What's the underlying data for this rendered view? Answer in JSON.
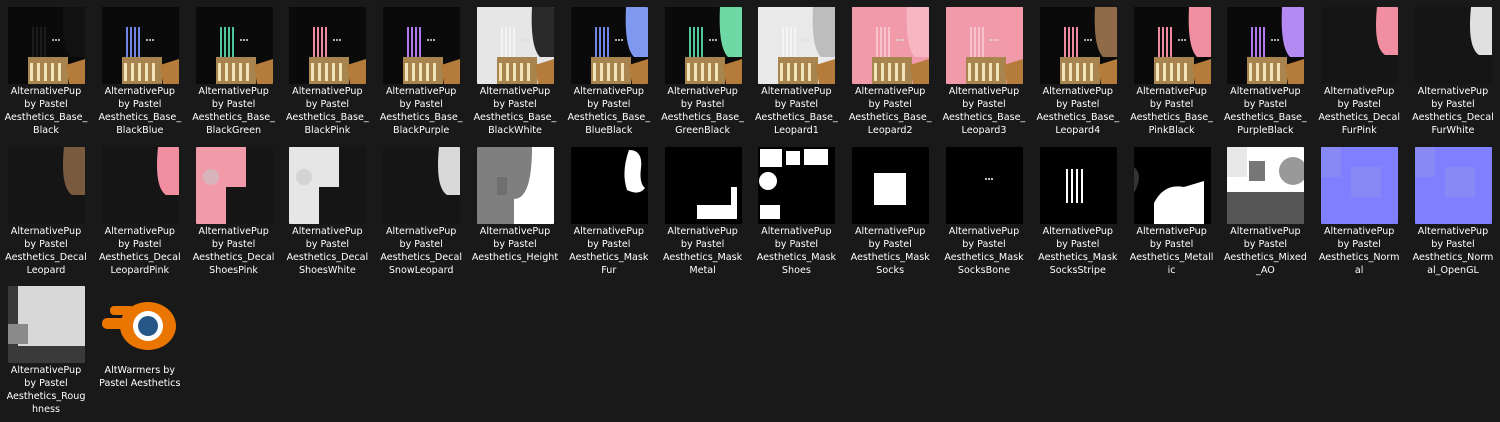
{
  "window": {
    "view": "Large icons"
  },
  "files": [
    {
      "name": "AlternativePup\nby Pastel\nAesthetics_Base_\nBlack",
      "kind": "base",
      "primary": "#0a0a0a",
      "stripe": "#1c1c1c",
      "decal": "#111111"
    },
    {
      "name": "AlternativePup\nby Pastel\nAesthetics_Base_\nBlackBlue",
      "kind": "base",
      "primary": "#0a0a0a",
      "stripe": "#6f86e6",
      "decal": "#0a0a0a"
    },
    {
      "name": "AlternativePup\nby Pastel\nAesthetics_Base_\nBlackGreen",
      "kind": "base",
      "primary": "#0a0a0a",
      "stripe": "#4fc79a",
      "decal": "#0a0a0a"
    },
    {
      "name": "AlternativePup\nby Pastel\nAesthetics_Base_\nBlackPink",
      "kind": "base",
      "primary": "#0a0a0a",
      "stripe": "#f08aa0",
      "decal": "#0a0a0a"
    },
    {
      "name": "AlternativePup\nby Pastel\nAesthetics_Base_\nBlackPurple",
      "kind": "base",
      "primary": "#0a0a0a",
      "stripe": "#b07af0",
      "decal": "#0a0a0a"
    },
    {
      "name": "AlternativePup\nby Pastel\nAesthetics_Base_\nBlackWhite",
      "kind": "base",
      "primary": "#e6e6e6",
      "stripe": "#f4f4f4",
      "decal": "#2a2a2a"
    },
    {
      "name": "AlternativePup\nby Pastel\nAesthetics_Base_\nBlueBlack",
      "kind": "base",
      "primary": "#0a0a0a",
      "stripe": "#6f86e6",
      "decal": "#7f99f0"
    },
    {
      "name": "AlternativePup\nby Pastel\nAesthetics_Base_\nGreenBlack",
      "kind": "base",
      "primary": "#0a0a0a",
      "stripe": "#4fc79a",
      "decal": "#6fd9a6"
    },
    {
      "name": "AlternativePup\nby Pastel\nAesthetics_Base_\nLeopard1",
      "kind": "base",
      "primary": "#e9e9e9",
      "stripe": "#f4f4f4",
      "decal": "#bdbdbd"
    },
    {
      "name": "AlternativePup\nby Pastel\nAesthetics_Base_\nLeopard2",
      "kind": "base",
      "primary": "#f19aaa",
      "stripe": "#f7c3cc",
      "decal": "#f6b7c3"
    },
    {
      "name": "AlternativePup\nby Pastel\nAesthetics_Base_\nLeopard3",
      "kind": "base",
      "primary": "#f19aaa",
      "stripe": "#f7c3cc",
      "decal": "#f29aa9"
    },
    {
      "name": "AlternativePup\nby Pastel\nAesthetics_Base_\nLeopard4",
      "kind": "base",
      "primary": "#0a0a0a",
      "stripe": "#f08aa0",
      "decal": "#8f6b4a"
    },
    {
      "name": "AlternativePup\nby Pastel\nAesthetics_Base_\nPinkBlack",
      "kind": "base",
      "primary": "#0a0a0a",
      "stripe": "#f08aa0",
      "decal": "#f18ea2"
    },
    {
      "name": "AlternativePup\nby Pastel\nAesthetics_Base_\nPurpleBlack",
      "kind": "base",
      "primary": "#0a0a0a",
      "stripe": "#b07af0",
      "decal": "#b589f2"
    },
    {
      "name": "AlternativePup\nby Pastel\nAesthetics_Decal\nFurPink",
      "kind": "decal",
      "primary": "#151515",
      "decal": "#f18ea2"
    },
    {
      "name": "AlternativePup\nby Pastel\nAesthetics_Decal\nFurWhite",
      "kind": "decal",
      "primary": "#151515",
      "decal": "#e0e0e0"
    },
    {
      "name": "AlternativePup\nby Pastel\nAesthetics_Decal\nLeopard",
      "kind": "decal",
      "primary": "#151515",
      "decal": "#7a5a3e"
    },
    {
      "name": "AlternativePup\nby Pastel\nAesthetics_Decal\nLeopardPink",
      "kind": "decal",
      "primary": "#151515",
      "decal": "#f18ea2"
    },
    {
      "name": "AlternativePup\nby Pastel\nAesthetics_Decal\nShoesPink",
      "kind": "shoes",
      "primary": "#151515",
      "decal": "#f19aaa"
    },
    {
      "name": "AlternativePup\nby Pastel\nAesthetics_Decal\nShoesWhite",
      "kind": "shoes",
      "primary": "#151515",
      "decal": "#e6e6e6"
    },
    {
      "name": "AlternativePup\nby Pastel\nAesthetics_Decal\nSnowLeopard",
      "kind": "decal",
      "primary": "#151515",
      "decal": "#d9d9d9"
    },
    {
      "name": "AlternativePup\nby Pastel\nAesthetics_Height",
      "kind": "height",
      "primary": "#7f7f7f",
      "decal": "#ffffff"
    },
    {
      "name": "AlternativePup\nby Pastel\nAesthetics_Mask\nFur",
      "kind": "maskfur",
      "primary": "#000000",
      "decal": "#ffffff"
    },
    {
      "name": "AlternativePup\nby Pastel\nAesthetics_Mask\nMetal",
      "kind": "maskmetal",
      "primary": "#000000",
      "decal": "#ffffff"
    },
    {
      "name": "AlternativePup\nby Pastel\nAesthetics_Mask\nShoes",
      "kind": "maskshoes",
      "primary": "#000000",
      "decal": "#ffffff"
    },
    {
      "name": "AlternativePup\nby Pastel\nAesthetics_Mask\nSocks",
      "kind": "masksocks",
      "primary": "#000000",
      "decal": "#ffffff"
    },
    {
      "name": "AlternativePup\nby Pastel\nAesthetics_Mask\nSocksBone",
      "kind": "maskbone",
      "primary": "#000000",
      "decal": "#ffffff"
    },
    {
      "name": "AlternativePup\nby Pastel\nAesthetics_Mask\nSocksStripe",
      "kind": "maskstripe",
      "primary": "#000000",
      "decal": "#ffffff"
    },
    {
      "name": "AlternativePup\nby Pastel\nAesthetics_Metall\nic",
      "kind": "metallic",
      "primary": "#000000",
      "decal": "#ffffff"
    },
    {
      "name": "AlternativePup\nby Pastel\nAesthetics_Mixed\n_AO",
      "kind": "ao",
      "primary": "#ffffff",
      "decal": "#2a2a2a"
    },
    {
      "name": "AlternativePup\nby Pastel\nAesthetics_Norm\nal",
      "kind": "normal",
      "primary": "#7f7fff",
      "decal": "#8f8ff0"
    },
    {
      "name": "AlternativePup\nby Pastel\nAesthetics_Norm\nal_OpenGL",
      "kind": "normal",
      "primary": "#7f7fff",
      "decal": "#8f8ff0"
    },
    {
      "name": "AlternativePup\nby Pastel\nAesthetics_Roug\nhness",
      "kind": "roughness",
      "primary": "#d8d8d8",
      "decal": "#3a3a3a"
    },
    {
      "name": "AltWarmers by\nPastel Aesthetics",
      "kind": "blender",
      "primary": "#ea7600",
      "decal": "#265787"
    }
  ]
}
